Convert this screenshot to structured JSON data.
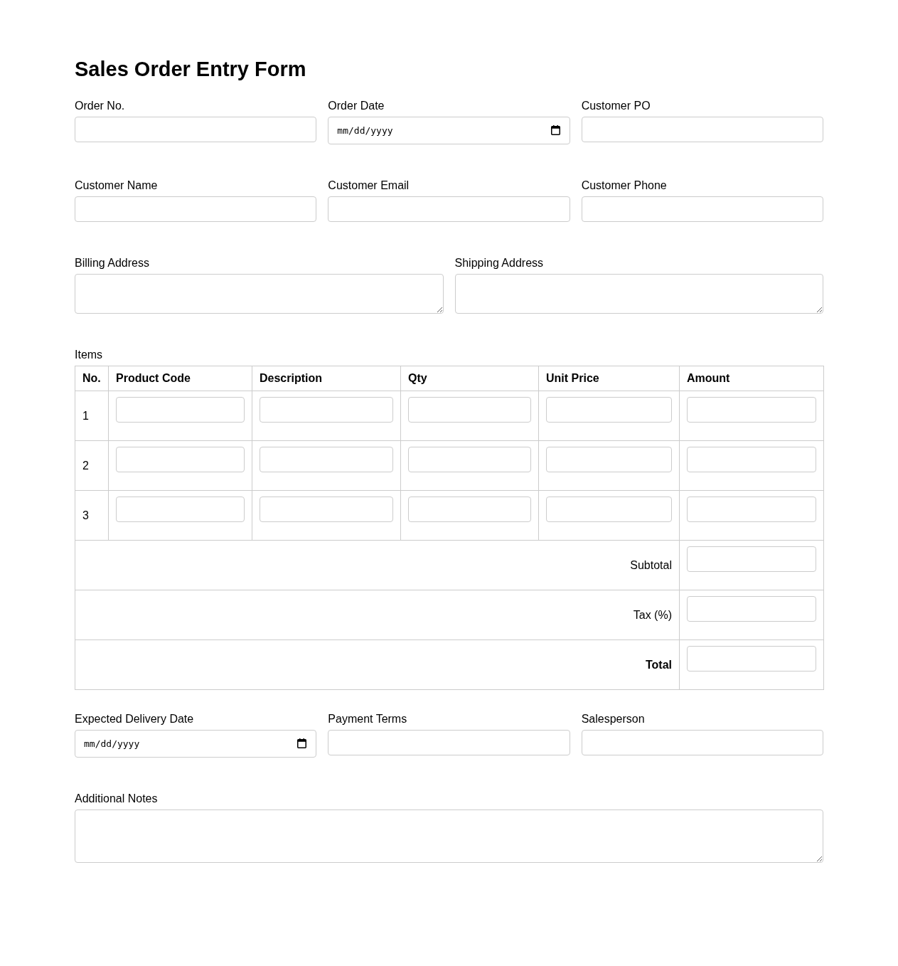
{
  "title": "Sales Order Entry Form",
  "order_details": [
    {
      "fields": [
        {
          "kind": "text",
          "label": "Order No."
        },
        {
          "kind": "date",
          "label": "Order Date",
          "placeholder": "mm/dd/yyyy"
        },
        {
          "kind": "text",
          "label": "Customer PO"
        }
      ]
    },
    {
      "fields": [
        {
          "kind": "text",
          "label": "Customer Name"
        },
        {
          "kind": "text",
          "label": "Customer Email"
        },
        {
          "kind": "text",
          "label": "Customer Phone"
        }
      ]
    },
    {
      "fields": [
        {
          "kind": "textarea",
          "label": "Billing Address"
        },
        {
          "kind": "textarea",
          "label": "Shipping Address"
        }
      ]
    }
  ],
  "items": {
    "label": "Items",
    "columns": [
      "No.",
      "Product Code",
      "Description",
      "Qty",
      "Unit Price",
      "Amount"
    ],
    "rows": [
      {
        "no": "1"
      },
      {
        "no": "2"
      },
      {
        "no": "3"
      }
    ],
    "summary": [
      {
        "label": "Subtotal",
        "bold": false
      },
      {
        "label": "Tax (%)",
        "bold": false
      },
      {
        "label": "Total",
        "bold": true
      }
    ]
  },
  "delivery_details": [
    {
      "fields": [
        {
          "kind": "date",
          "label": "Expected Delivery Date",
          "placeholder": "mm/dd/yyyy"
        },
        {
          "kind": "text",
          "label": "Payment Terms"
        },
        {
          "kind": "text",
          "label": "Salesperson"
        }
      ]
    },
    {
      "fields": [
        {
          "kind": "notes",
          "label": "Additional Notes"
        }
      ]
    }
  ]
}
